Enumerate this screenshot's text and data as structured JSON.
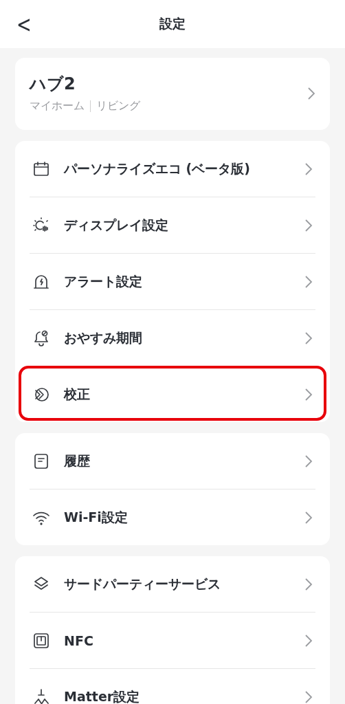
{
  "header": {
    "title": "設定",
    "back": "<"
  },
  "device": {
    "name": "ハブ2",
    "home": "マイホーム",
    "room": "リビング"
  },
  "groups": [
    {
      "items": [
        {
          "label": "パーソナライズエコ (ベータ版)",
          "highlighted": false
        },
        {
          "label": "ディスプレイ設定",
          "highlighted": false
        },
        {
          "label": "アラート設定",
          "highlighted": false
        },
        {
          "label": "おやすみ期間",
          "highlighted": false
        },
        {
          "label": "校正",
          "highlighted": true
        }
      ]
    },
    {
      "items": [
        {
          "label": "履歴",
          "highlighted": false
        },
        {
          "label": "Wi-Fi設定",
          "highlighted": false
        }
      ]
    },
    {
      "items": [
        {
          "label": "サードパーティーサービス",
          "highlighted": false
        },
        {
          "label": "NFC",
          "highlighted": false
        },
        {
          "label": "Matter設定",
          "highlighted": false
        }
      ]
    }
  ]
}
